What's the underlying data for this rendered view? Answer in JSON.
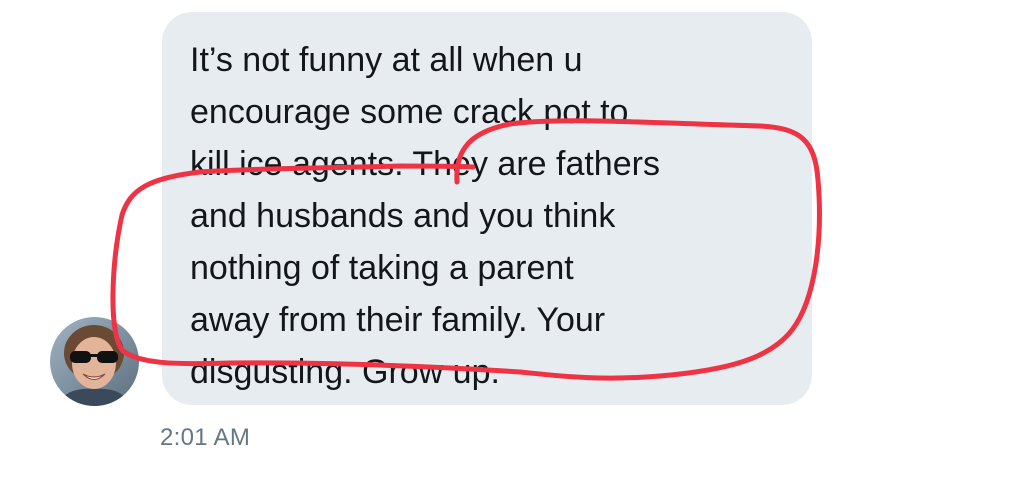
{
  "message": {
    "lines": [
      "It’s not funny at all when u",
      "encourage some crack pot to",
      "kill ice agents. They are fathers",
      "and husbands and you think",
      "nothing of taking a parent",
      "away from their family. Your",
      "disgusting. Grow up."
    ],
    "timestamp": "2:01 AM"
  },
  "colors": {
    "bubble": "#e6ecf0",
    "text": "#14171a",
    "timestamp": "#657786",
    "annotation": "#ee3344"
  },
  "icons": {
    "avatar": "user-avatar-photo"
  }
}
